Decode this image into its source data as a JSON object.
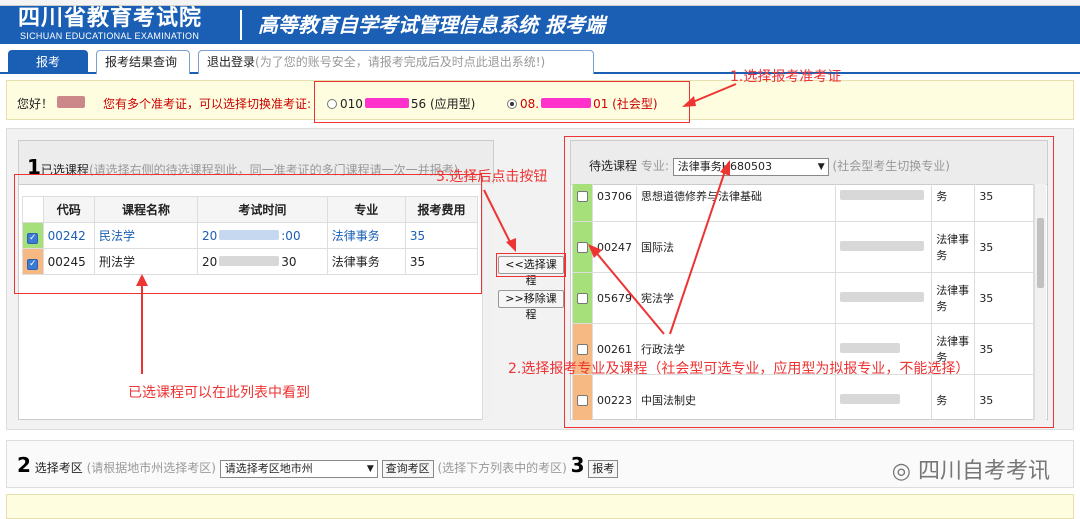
{
  "header": {
    "logo_text": "四川省教育考试院",
    "logo_sub": "SICHUAN EDUCATIONAL EXAMINATION",
    "system_title": "高等教育自学考试管理信息系统  报考端"
  },
  "nav": {
    "tab_register": "报考",
    "tab_result": "报考结果查询",
    "tab_logout": "退出登录",
    "logout_hint": "(为了您的账号安全，请报考完成后及时点此退出系统!)"
  },
  "info": {
    "hello": "您好！",
    "warning": "您有多个准考证，可以选择切换准考证:",
    "option1_a": "010",
    "option1_b": "56 (应用型)",
    "option2_a": "08.",
    "option2_b": "01 (社会型)"
  },
  "annotations": {
    "a1": "1.选择报考准考证",
    "a2": "2.选择报考专业及课程（社会型可选专业，应用型为拟报专业，不能选择）",
    "a3": "3.选择后点击按钮",
    "a4": "已选课程可以在此列表中看到"
  },
  "left": {
    "num": "1",
    "title": "已选课程",
    "hint": "(请选择右侧的待选课程到此，同一准考证的多门课程请一次一并报考)",
    "headers": [
      "代码",
      "课程名称",
      "考试时间",
      "专业",
      "报考费用"
    ],
    "rows": [
      {
        "code": "00242",
        "name": "民法学",
        "time_a": "20",
        "time_b": ":00",
        "major": "法律事务",
        "fee": "35"
      },
      {
        "code": "00245",
        "name": "刑法学",
        "time_a": "20",
        "time_b": "30",
        "major": "法律事务",
        "fee": "35"
      }
    ]
  },
  "buttons": {
    "select": "<<选择课程",
    "remove": ">>移除课程"
  },
  "right": {
    "title": "待选课程",
    "major_label": "专业:",
    "major_value": "法律事务H680503",
    "hint": "(社会型考生切换专业)",
    "rows": [
      {
        "code": "03706",
        "name": "思想道德修养与法律基础",
        "time": "",
        "major": "务",
        "fee": "35"
      },
      {
        "code": "00247",
        "name": "国际法",
        "time": "",
        "major": "法律事务",
        "fee": "35"
      },
      {
        "code": "05679",
        "name": "宪法学",
        "time": "",
        "major": "法律事务",
        "fee": "35"
      },
      {
        "code": "00261",
        "name": "行政法学",
        "time": "",
        "major": "法律事务",
        "fee": "35"
      },
      {
        "code": "00223",
        "name": "中国法制史",
        "time": "",
        "major": "务",
        "fee": "35"
      }
    ]
  },
  "sec2": {
    "num2": "2",
    "label": "选择考区",
    "hint": "(请根据地市州选择考区)",
    "select": "请选择考区地市州",
    "query_btn": "查询考区",
    "hint2": "(选择下方列表中的考区)",
    "num3": "3",
    "submit": "报考"
  },
  "watermark": "四川自考考讯"
}
